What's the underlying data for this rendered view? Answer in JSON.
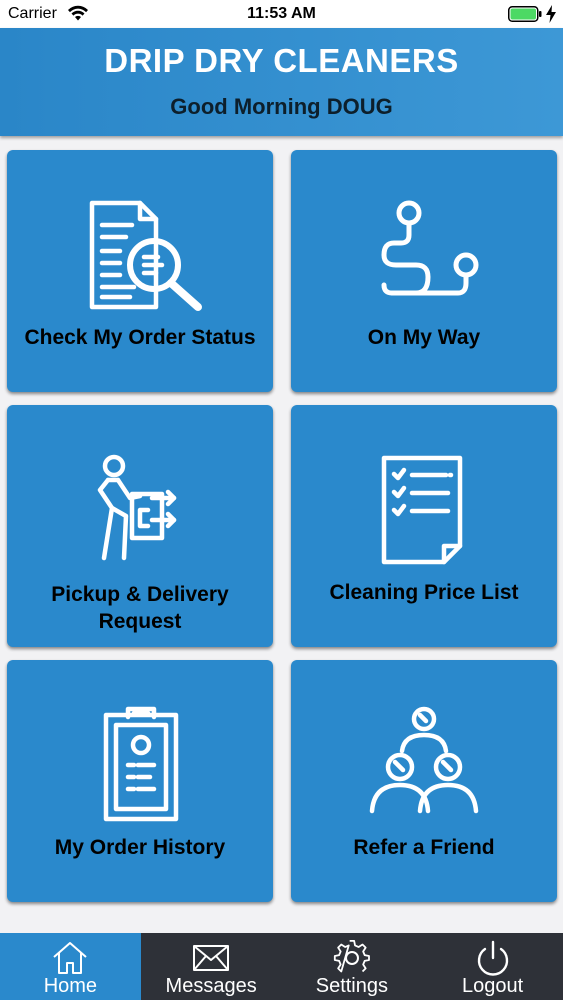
{
  "status_bar": {
    "carrier": "Carrier",
    "time": "11:53 AM",
    "battery_color": "#4cd964"
  },
  "header": {
    "title": "DRIP DRY CLEANERS",
    "greeting": "Good Morning DOUG"
  },
  "tiles": [
    {
      "label": "Check My Order Status",
      "icon": "document-search-icon"
    },
    {
      "label": "On My Way",
      "icon": "route-icon"
    },
    {
      "label": "Pickup & Delivery Request",
      "icon": "delivery-person-icon"
    },
    {
      "label": "Cleaning Price List",
      "icon": "checklist-icon"
    },
    {
      "label": "My Order History",
      "icon": "clipboard-icon"
    },
    {
      "label": "Refer a Friend",
      "icon": "referral-people-icon"
    }
  ],
  "tab_bar": {
    "tabs": [
      {
        "label": "Home",
        "icon": "home-icon",
        "active": true
      },
      {
        "label": "Messages",
        "icon": "envelope-icon",
        "active": false
      },
      {
        "label": "Settings",
        "icon": "gear-icon",
        "active": false
      },
      {
        "label": "Logout",
        "icon": "power-icon",
        "active": false
      }
    ]
  },
  "colors": {
    "tile_blue": "#2a89cc",
    "header_blue": "#3d98d6",
    "tab_bar_dark": "#2e3138"
  }
}
